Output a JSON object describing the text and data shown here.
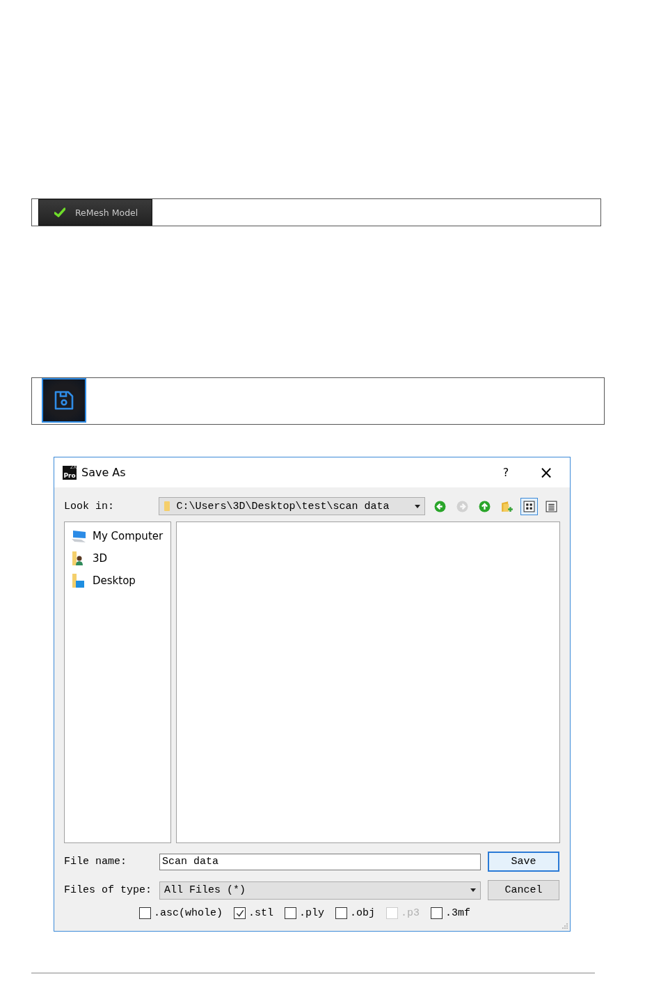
{
  "remesh_panel": {
    "button": {
      "label": "ReMesh Model",
      "checked": true
    }
  },
  "save_panel": {
    "button": {
      "selected": true
    }
  },
  "dialog": {
    "app_icon": {
      "text": "Pro",
      "superscript": "2X"
    },
    "title": "Save As",
    "help": "?",
    "close": "×",
    "look_in": {
      "label": "Look in:",
      "path": "C:\\Users\\3D\\Desktop\\test\\scan data"
    },
    "toolbar": [
      {
        "kind": "back",
        "disabled": false,
        "selected": false
      },
      {
        "kind": "forward",
        "disabled": true,
        "selected": false
      },
      {
        "kind": "up",
        "disabled": false,
        "selected": false
      },
      {
        "kind": "new-folder",
        "disabled": false,
        "selected": false
      },
      {
        "kind": "icon-view",
        "disabled": false,
        "selected": true
      },
      {
        "kind": "list-view",
        "disabled": false,
        "selected": false
      }
    ],
    "sidebar": {
      "items": [
        {
          "kind": "computer",
          "label": "My Computer"
        },
        {
          "kind": "user-folder",
          "label": "3D"
        },
        {
          "kind": "desktop-folder",
          "label": "Desktop"
        }
      ]
    },
    "file_name": {
      "label": "File name:",
      "value": "Scan data"
    },
    "file_type": {
      "label": "Files of type:",
      "value": "All Files (*)"
    },
    "buttons": [
      {
        "label": "Save",
        "selected": true
      },
      {
        "label": "Cancel",
        "selected": false
      }
    ],
    "formats": [
      {
        "label": ".asc(whole)",
        "checked": false,
        "disabled": false
      },
      {
        "label": ".stl",
        "checked": true,
        "disabled": false
      },
      {
        "label": ".ply",
        "checked": false,
        "disabled": false
      },
      {
        "label": ".obj",
        "checked": false,
        "disabled": false
      },
      {
        "label": ".p3",
        "checked": false,
        "disabled": true
      },
      {
        "label": ".3mf",
        "checked": false,
        "disabled": false
      }
    ]
  }
}
